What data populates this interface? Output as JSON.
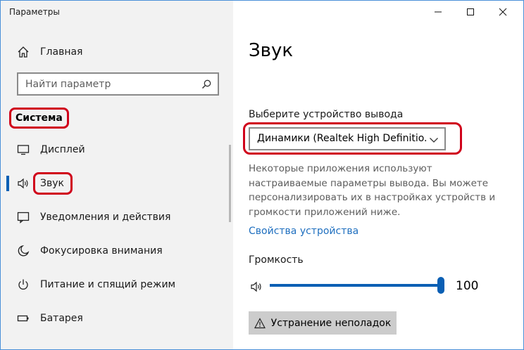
{
  "window": {
    "title": "Параметры",
    "minimize_icon": "minimize-icon",
    "maximize_icon": "maximize-icon",
    "close_icon": "close-icon"
  },
  "sidebar": {
    "home": {
      "label": "Главная",
      "icon": "home-icon"
    },
    "search": {
      "placeholder": "Найти параметр",
      "icon": "search-icon"
    },
    "section_header": "Система",
    "items": [
      {
        "label": "Дисплей",
        "icon": "display-icon"
      },
      {
        "label": "Звук",
        "icon": "speaker-icon",
        "active": true
      },
      {
        "label": "Уведомления и действия",
        "icon": "notification-icon"
      },
      {
        "label": "Фокусировка внимания",
        "icon": "moon-icon"
      },
      {
        "label": "Питание и спящий режим",
        "icon": "power-icon"
      },
      {
        "label": "Батарея",
        "icon": "battery-icon"
      }
    ]
  },
  "main": {
    "title": "Звук",
    "output_label": "Выберите устройство вывода",
    "output_device": "Динамики (Realtek High Definitio...",
    "description": "Некоторые приложения используют настраиваемые параметры вывода. Вы можете персонализировать их в настройках устройств и громкости приложений ниже.",
    "device_properties_link": "Свойства устройства",
    "volume_label": "Громкость",
    "volume_value": "100",
    "volume_level": 100,
    "troubleshoot_label": "Устранение неполадок"
  },
  "colors": {
    "accent": "#0a5fb4",
    "link": "#1f6fbf",
    "highlight_ring": "#d0021b",
    "sidebar_bg": "#f2f2f2"
  }
}
